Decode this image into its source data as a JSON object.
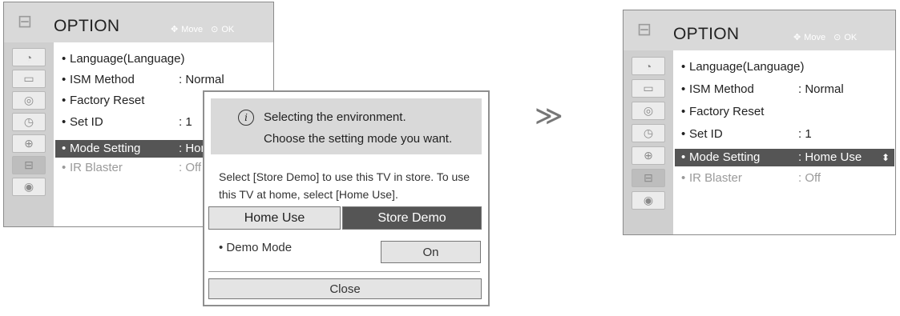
{
  "left_menu": {
    "title": "OPTION",
    "hint_move": "Move",
    "hint_ok": "OK",
    "items": [
      {
        "label": "Language(Language)",
        "value": ""
      },
      {
        "label": "ISM Method",
        "value": ": Normal"
      },
      {
        "label": "Factory Reset",
        "value": ""
      },
      {
        "label": "Set ID",
        "value": ": 1"
      },
      {
        "label": "Mode Setting",
        "value": ": Hor"
      },
      {
        "label": "IR Blaster",
        "value": ": Off"
      }
    ]
  },
  "dialog": {
    "line1": "Selecting the environment.",
    "line2": "Choose the setting mode you want.",
    "description": "Select [Store Demo] to use this TV in store. To use this TV at home, select [Home Use].",
    "option_home": "Home Use",
    "option_store": "Store Demo",
    "demo_mode_label": "• Demo Mode",
    "demo_mode_value": "On",
    "close_label": "Close"
  },
  "arrow_glyph": "≫",
  "right_menu": {
    "title": "OPTION",
    "hint_move": "Move",
    "hint_ok": "OK",
    "items": [
      {
        "label": "Language(Language)",
        "value": ""
      },
      {
        "label": "ISM Method",
        "value": ": Normal"
      },
      {
        "label": "Factory Reset",
        "value": ""
      },
      {
        "label": "Set ID",
        "value": ": 1"
      },
      {
        "label": "Mode Setting",
        "value": ": Home Use"
      },
      {
        "label": "IR Blaster",
        "value": ": Off"
      }
    ]
  },
  "icons": [
    "option-icon",
    "disc-icon",
    "monitor-icon",
    "speaker-icon",
    "clock-icon",
    "lock-icon",
    "option-icon",
    "globe-icon"
  ]
}
